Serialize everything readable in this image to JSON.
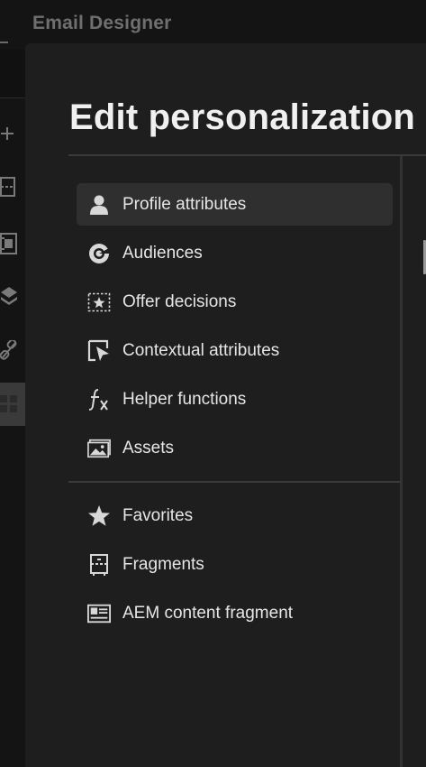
{
  "app": {
    "title": "Email Designer"
  },
  "rail": {
    "items": [
      {
        "icon": "plus-icon"
      },
      {
        "icon": "fragment-icon"
      },
      {
        "icon": "film-icon"
      },
      {
        "icon": "layers-icon"
      },
      {
        "icon": "link-icon"
      },
      {
        "icon": "grid-icon",
        "active": true
      }
    ]
  },
  "modal": {
    "title": "Edit personalization",
    "primary_items": [
      {
        "label": "Profile attributes",
        "icon": "user-icon",
        "selected": true
      },
      {
        "label": "Audiences",
        "icon": "audience-icon"
      },
      {
        "label": "Offer decisions",
        "icon": "offer-icon"
      },
      {
        "label": "Contextual attributes",
        "icon": "contextual-icon"
      },
      {
        "label": "Helper functions",
        "icon": "function-icon"
      },
      {
        "label": "Assets",
        "icon": "image-icon"
      }
    ],
    "secondary_items": [
      {
        "label": "Favorites",
        "icon": "star-icon"
      },
      {
        "label": "Fragments",
        "icon": "fragment-icon"
      },
      {
        "label": "AEM content fragment",
        "icon": "content-fragment-icon"
      }
    ]
  },
  "colors": {
    "background": "#111111",
    "modal": "#1e1e1e",
    "selected": "#2f2f2f",
    "text": "#e6e6e6",
    "title_dim": "#6f6f6f"
  }
}
